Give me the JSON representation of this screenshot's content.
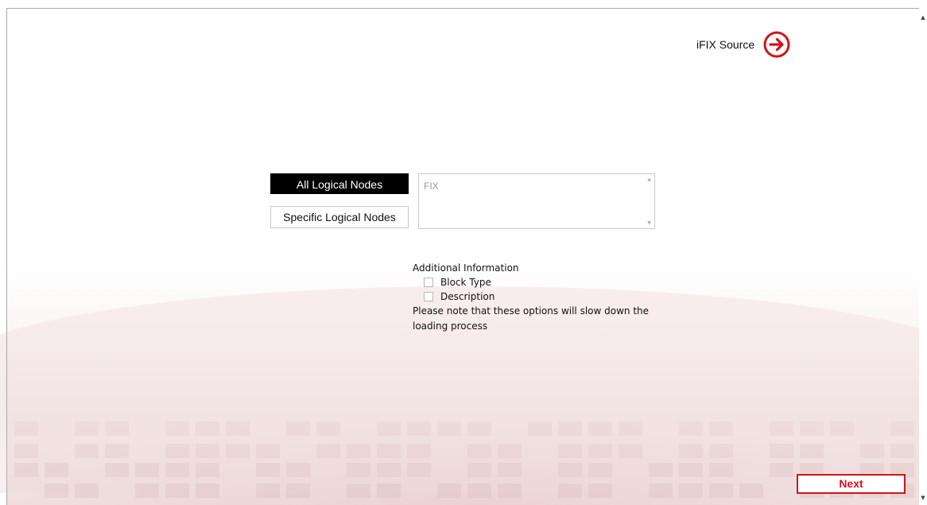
{
  "header": {
    "source_label": "iFIX Source",
    "source_icon": "arrow-right-circle-icon"
  },
  "node_selection": {
    "all_nodes_label": "All Logical Nodes",
    "specific_nodes_label": "Specific Logical Nodes",
    "selected": "All Logical Nodes",
    "node_list": [
      "FIX"
    ]
  },
  "additional_info": {
    "title": "Additional Information",
    "options": [
      {
        "label": "Block Type",
        "checked": false
      },
      {
        "label": "Description",
        "checked": false
      }
    ],
    "note": "Please note that these options will slow down the loading process"
  },
  "footer": {
    "next_label": "Next"
  },
  "colors": {
    "accent": "#d0141c",
    "selected_button_bg": "#000000",
    "selected_button_text": "#ffffff",
    "disabled_text": "#9a9a9a"
  }
}
